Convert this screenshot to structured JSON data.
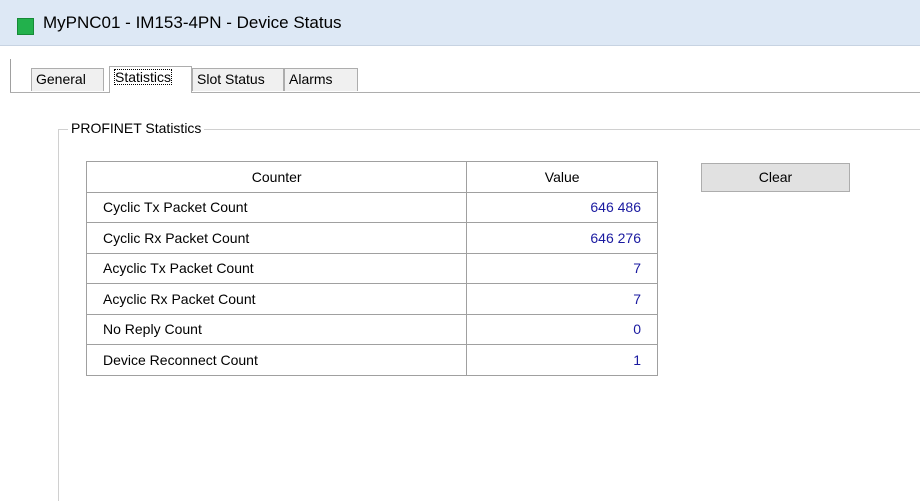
{
  "window": {
    "title": "MyPNC01 - IM153-4PN - Device Status",
    "icon_color": "#22b14c"
  },
  "tabs": [
    {
      "label": "General",
      "active": false
    },
    {
      "label": "Statistics",
      "active": true
    },
    {
      "label": "Slot Status",
      "active": false
    },
    {
      "label": "Alarms",
      "active": false
    }
  ],
  "statistics": {
    "group_title": "PROFINET Statistics",
    "columns": [
      "Counter",
      "Value"
    ],
    "rows": [
      {
        "counter": "Cyclic Tx Packet Count",
        "value": "646 486"
      },
      {
        "counter": "Cyclic Rx Packet Count",
        "value": "646 276"
      },
      {
        "counter": "Acyclic Tx Packet Count",
        "value": "7"
      },
      {
        "counter": "Acyclic Rx Packet Count",
        "value": "7"
      },
      {
        "counter": "No Reply Count",
        "value": "0"
      },
      {
        "counter": "Device Reconnect Count",
        "value": "1"
      }
    ],
    "clear_label": "Clear",
    "value_color": "#1a1aa0"
  }
}
